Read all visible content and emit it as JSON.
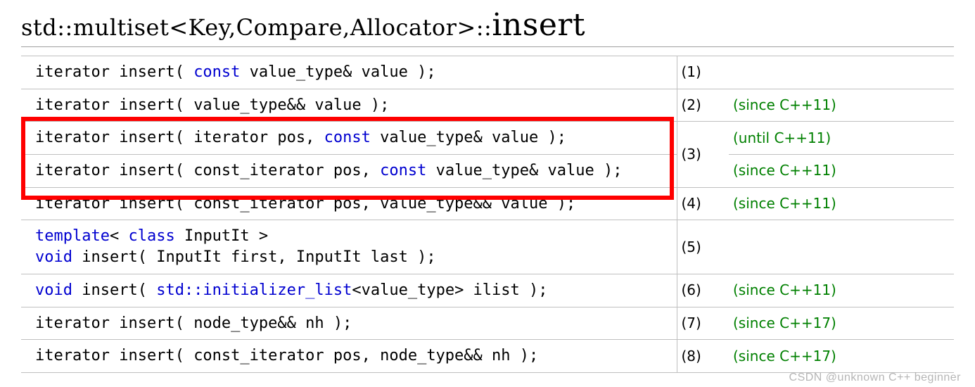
{
  "heading": {
    "prefix": "std::multiset<Key,Compare,Allocator>::",
    "name": "insert"
  },
  "rows": [
    {
      "no": "(1)",
      "vers": "",
      "code": [
        [
          {
            "t": "iterator insert",
            "c": ""
          },
          {
            "t": "( ",
            "c": ""
          },
          {
            "t": "const",
            "c": "kw"
          },
          {
            "t": " value_type",
            "c": ""
          },
          {
            "t": "&",
            "c": ""
          },
          {
            "t": " value ",
            "c": ""
          },
          {
            "t": ")",
            "c": ""
          },
          {
            "t": ";",
            "c": ""
          }
        ]
      ]
    },
    {
      "no": "(2)",
      "vers": "(since C++11)",
      "code": [
        [
          {
            "t": "iterator insert",
            "c": ""
          },
          {
            "t": "( ",
            "c": ""
          },
          {
            "t": "value_type",
            "c": ""
          },
          {
            "t": "&&",
            "c": ""
          },
          {
            "t": " value ",
            "c": ""
          },
          {
            "t": ")",
            "c": ""
          },
          {
            "t": ";",
            "c": ""
          }
        ]
      ]
    },
    {
      "no": "",
      "vers": "(until C++11)",
      "code": [
        [
          {
            "t": "iterator insert",
            "c": ""
          },
          {
            "t": "( ",
            "c": ""
          },
          {
            "t": "iterator pos, ",
            "c": ""
          },
          {
            "t": "const",
            "c": "kw"
          },
          {
            "t": " value_type",
            "c": ""
          },
          {
            "t": "&",
            "c": ""
          },
          {
            "t": " value ",
            "c": ""
          },
          {
            "t": ")",
            "c": ""
          },
          {
            "t": ";",
            "c": ""
          }
        ]
      ],
      "join_below_no": true
    },
    {
      "no": "(3)",
      "vers": "(since C++11)",
      "code": [
        [
          {
            "t": "iterator insert",
            "c": ""
          },
          {
            "t": "( ",
            "c": ""
          },
          {
            "t": "const_iterator pos, ",
            "c": ""
          },
          {
            "t": "const",
            "c": "kw"
          },
          {
            "t": " value_type",
            "c": ""
          },
          {
            "t": "&",
            "c": ""
          },
          {
            "t": " value ",
            "c": ""
          },
          {
            "t": ")",
            "c": ""
          },
          {
            "t": ";",
            "c": ""
          }
        ]
      ],
      "is_no_from_above": true
    },
    {
      "no": "(4)",
      "vers": "(since C++11)",
      "code": [
        [
          {
            "t": "iterator insert",
            "c": ""
          },
          {
            "t": "( ",
            "c": ""
          },
          {
            "t": "const_iterator pos, value_type",
            "c": ""
          },
          {
            "t": "&&",
            "c": ""
          },
          {
            "t": " value ",
            "c": ""
          },
          {
            "t": ")",
            "c": ""
          },
          {
            "t": ";",
            "c": ""
          }
        ]
      ]
    },
    {
      "no": "(5)",
      "vers": "",
      "code": [
        [
          {
            "t": "template",
            "c": "kw"
          },
          {
            "t": "<",
            "c": ""
          },
          {
            "t": " ",
            "c": ""
          },
          {
            "t": "class",
            "c": "kw"
          },
          {
            "t": " InputIt ",
            "c": ""
          },
          {
            "t": ">",
            "c": ""
          }
        ],
        [
          {
            "t": "void",
            "c": "kw"
          },
          {
            "t": " insert",
            "c": ""
          },
          {
            "t": "( ",
            "c": ""
          },
          {
            "t": "InputIt first, InputIt last ",
            "c": ""
          },
          {
            "t": ")",
            "c": ""
          },
          {
            "t": ";",
            "c": ""
          }
        ]
      ]
    },
    {
      "no": "(6)",
      "vers": "(since C++11)",
      "code": [
        [
          {
            "t": "void",
            "c": "kw"
          },
          {
            "t": " insert",
            "c": ""
          },
          {
            "t": "( ",
            "c": ""
          },
          {
            "t": "std::initializer_list",
            "c": "tok-link"
          },
          {
            "t": "<",
            "c": ""
          },
          {
            "t": "value_type",
            "c": ""
          },
          {
            "t": ">",
            "c": ""
          },
          {
            "t": " ilist ",
            "c": ""
          },
          {
            "t": ")",
            "c": ""
          },
          {
            "t": ";",
            "c": ""
          }
        ]
      ]
    },
    {
      "no": "(7)",
      "vers": "(since C++17)",
      "code": [
        [
          {
            "t": "iterator insert",
            "c": ""
          },
          {
            "t": "( ",
            "c": ""
          },
          {
            "t": "node_type",
            "c": ""
          },
          {
            "t": "&&",
            "c": ""
          },
          {
            "t": " nh ",
            "c": ""
          },
          {
            "t": ")",
            "c": ""
          },
          {
            "t": ";",
            "c": ""
          }
        ]
      ]
    },
    {
      "no": "(8)",
      "vers": "(since C++17)",
      "code": [
        [
          {
            "t": "iterator insert",
            "c": ""
          },
          {
            "t": "( ",
            "c": ""
          },
          {
            "t": "const_iterator pos, node_type",
            "c": ""
          },
          {
            "t": "&&",
            "c": ""
          },
          {
            "t": " nh ",
            "c": ""
          },
          {
            "t": ")",
            "c": ""
          },
          {
            "t": ";",
            "c": ""
          }
        ]
      ]
    }
  ],
  "watermark": "CSDN @unknown C++ beginner"
}
